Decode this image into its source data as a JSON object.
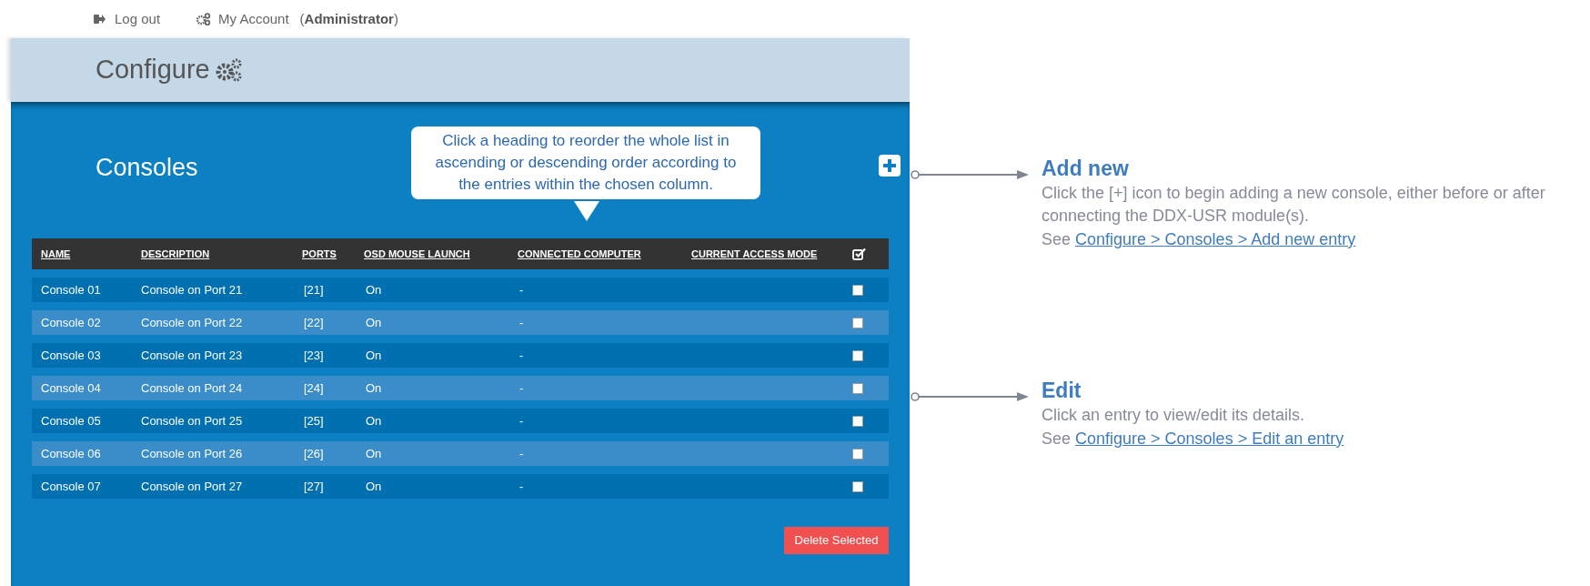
{
  "top_bar": {
    "logout": "Log out",
    "account": "My Account",
    "account_role_open": "(",
    "account_role": "Administrator",
    "account_role_close": ")"
  },
  "page_header": {
    "title": "Configure"
  },
  "panel": {
    "title": "Consoles",
    "tooltip": "Click a heading to reorder the whole list in ascending or descending order according to the entries within the chosen column.",
    "table": {
      "columns": [
        "NAME",
        "DESCRIPTION",
        "PORTS",
        "OSD MOUSE LAUNCH",
        "CONNECTED COMPUTER",
        "CURRENT ACCESS MODE"
      ],
      "rows": [
        {
          "cells": [
            "Console 01",
            "Console on Port 21",
            "[21]",
            "On",
            "-",
            ""
          ],
          "checked": false
        },
        {
          "cells": [
            "Console 02",
            "Console on Port 22",
            "[22]",
            "On",
            "-",
            ""
          ],
          "checked": false
        },
        {
          "cells": [
            "Console 03",
            "Console on Port 23",
            "[23]",
            "On",
            "-",
            ""
          ],
          "checked": false
        },
        {
          "cells": [
            "Console 04",
            "Console on Port 24",
            "[24]",
            "On",
            "-",
            ""
          ],
          "checked": false
        },
        {
          "cells": [
            "Console 05",
            "Console on Port 25",
            "[25]",
            "On",
            "-",
            ""
          ],
          "checked": false
        },
        {
          "cells": [
            "Console 06",
            "Console on Port 26",
            "[26]",
            "On",
            "-",
            ""
          ],
          "checked": false
        },
        {
          "cells": [
            "Console 07",
            "Console on Port 27",
            "[27]",
            "On",
            "-",
            ""
          ],
          "checked": false
        }
      ]
    },
    "delete_button": "Delete Selected"
  },
  "annotations": [
    {
      "title": "Add new",
      "body": "Click the [+] icon to begin adding a new console, either before or after connecting the DDX-USR module(s).",
      "link_prefix": "See",
      "link": "Configure > Consoles > Add new entry"
    },
    {
      "title": "Edit",
      "body": "Click an entry to view/edit its details.",
      "link_prefix": "See",
      "link": "Configure > Consoles > Edit an entry"
    }
  ]
}
